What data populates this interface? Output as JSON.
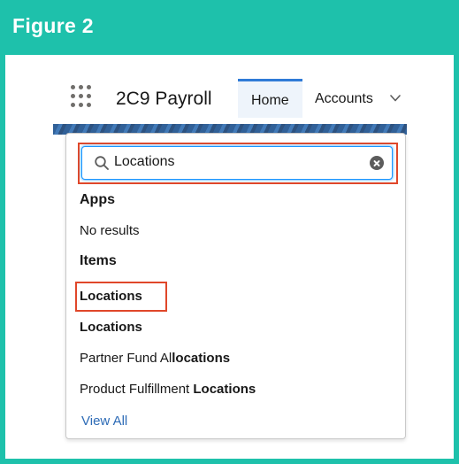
{
  "figure": {
    "title": "Figure 2"
  },
  "colors": {
    "frame": "#1ec1ab",
    "highlight": "#e0472a",
    "link": "#2d6bb6",
    "focus": "#1b96ff"
  },
  "nav": {
    "app_name": "2C9 Payroll",
    "tabs": [
      {
        "label": "Home",
        "active": true
      },
      {
        "label": "Accounts",
        "active": false
      }
    ],
    "launcher_icon": "app-launcher-grid-icon",
    "dropdown_icon": "chevron-down-icon"
  },
  "search": {
    "value": "Locations",
    "icon": "search-icon",
    "clear_icon": "clear-icon"
  },
  "results": {
    "apps_header": "Apps",
    "apps_empty": "No results",
    "items_header": "Items",
    "items": [
      {
        "prefix": "",
        "match": "Locations",
        "highlighted": true
      },
      {
        "prefix": "",
        "match": "Locations",
        "highlighted": false
      },
      {
        "prefix": "Partner Fund Al",
        "match": "locations",
        "highlighted": false
      },
      {
        "prefix": "Product Fulfillment ",
        "match": "Locations",
        "highlighted": false
      }
    ],
    "view_all": "View All"
  }
}
